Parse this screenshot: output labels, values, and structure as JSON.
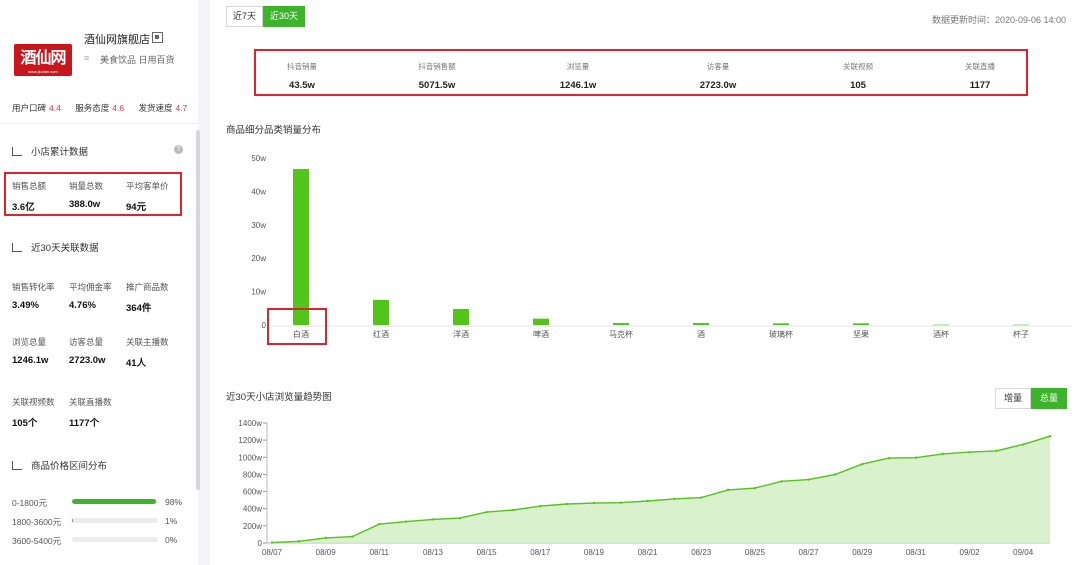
{
  "shop": {
    "logo_text": "酒仙网",
    "logo_sub": "www.jiuxian.com",
    "name": "酒仙网旗舰店",
    "category_icon": "≡",
    "category": "美食饮品 日用百货",
    "ratings": [
      {
        "label": "用户口碑",
        "score": "4.4"
      },
      {
        "label": "服务态度",
        "score": "4.6"
      },
      {
        "label": "发货速度",
        "score": "4.7"
      }
    ]
  },
  "cumulative": {
    "title": "小店累计数据",
    "help": "?",
    "stats": [
      {
        "label": "销售总额",
        "value": "3.6亿"
      },
      {
        "label": "销量总数",
        "value": "388.0w"
      },
      {
        "label": "平均客单价",
        "value": "94元"
      }
    ]
  },
  "recent": {
    "title": "近30天关联数据",
    "row1": [
      {
        "label": "销售转化率",
        "value": "3.49%"
      },
      {
        "label": "平均佣金率",
        "value": "4.76%"
      },
      {
        "label": "推广商品数",
        "value": "364件"
      }
    ],
    "row2": [
      {
        "label": "浏览总量",
        "value": "1246.1w"
      },
      {
        "label": "访客总量",
        "value": "2723.0w"
      },
      {
        "label": "关联主播数",
        "value": "41人"
      }
    ],
    "row3": [
      {
        "label": "关联视频数",
        "value": "105个"
      },
      {
        "label": "关联直播数",
        "value": "1177个"
      }
    ]
  },
  "price_dist": {
    "title": "商品价格区间分布",
    "items": [
      {
        "label": "0-1800元",
        "pct": "98%",
        "fraction": 0.98
      },
      {
        "label": "1800-3600元",
        "pct": "1%",
        "fraction": 0.01
      },
      {
        "label": "3600-5400元",
        "pct": "0%",
        "fraction": 0.0
      }
    ]
  },
  "main": {
    "tabs": [
      "近7天",
      "近30天"
    ],
    "active_tab": 1,
    "update_time": "数据更新时间：2020-09-06 14:00",
    "summary": [
      {
        "label": "抖音销量",
        "value": "43.5w"
      },
      {
        "label": "抖音销售额",
        "value": "5071.5w"
      },
      {
        "label": "浏览量",
        "value": "1246.1w"
      },
      {
        "label": "访客量",
        "value": "2723.0w"
      },
      {
        "label": "关联视频",
        "value": "105"
      },
      {
        "label": "关联直播",
        "value": "1177"
      }
    ],
    "bar_title": "商品细分品类销量分布",
    "line_title": "近30天小店浏览量趋势图",
    "toggle": [
      "增量",
      "总量"
    ],
    "toggle_active": 1
  },
  "chart_data": [
    {
      "type": "bar",
      "title": "商品细分品类销量分布",
      "categories": [
        "白酒",
        "红酒",
        "洋酒",
        "啤酒",
        "马克杯",
        "酒",
        "玻璃杯",
        "坚果",
        "酒杯",
        "杯子"
      ],
      "values": [
        46.7,
        7.5,
        4.8,
        1.9,
        0.6,
        0.6,
        0.5,
        0.5,
        0.1,
        0.1
      ],
      "y_ticks": [
        "0",
        "10w",
        "20w",
        "30w",
        "40w",
        "50w"
      ],
      "ylim": [
        0,
        50
      ],
      "color": "#52c41a",
      "highlight_color": "#d9262e"
    },
    {
      "type": "area",
      "title": "近30天小店浏览量趋势图",
      "x": [
        "08/07",
        "08/08",
        "08/09",
        "08/10",
        "08/11",
        "08/12",
        "08/13",
        "08/14",
        "08/15",
        "08/16",
        "08/17",
        "08/18",
        "08/19",
        "08/20",
        "08/21",
        "08/22",
        "08/23",
        "08/24",
        "08/25",
        "08/26",
        "08/27",
        "08/28",
        "08/29",
        "08/30",
        "08/31",
        "09/01",
        "09/02",
        "09/03",
        "09/04",
        "09/05"
      ],
      "x_ticks": [
        "08/07",
        "08/09",
        "08/11",
        "08/13",
        "08/15",
        "08/17",
        "08/19",
        "08/21",
        "08/23",
        "08/25",
        "08/27",
        "08/29",
        "08/31",
        "09/02",
        "09/04"
      ],
      "values": [
        5,
        20,
        60,
        75,
        220,
        250,
        275,
        290,
        360,
        385,
        430,
        455,
        465,
        470,
        490,
        515,
        530,
        620,
        640,
        720,
        740,
        800,
        920,
        990,
        995,
        1040,
        1060,
        1075,
        1150,
        1246
      ],
      "y_ticks": [
        "0",
        "200w",
        "400w",
        "600w",
        "800w",
        "1000w",
        "1200w",
        "1400w"
      ],
      "ylim": [
        0,
        1400
      ],
      "color": "#52c41a",
      "fill": "#cfeec0"
    }
  ]
}
